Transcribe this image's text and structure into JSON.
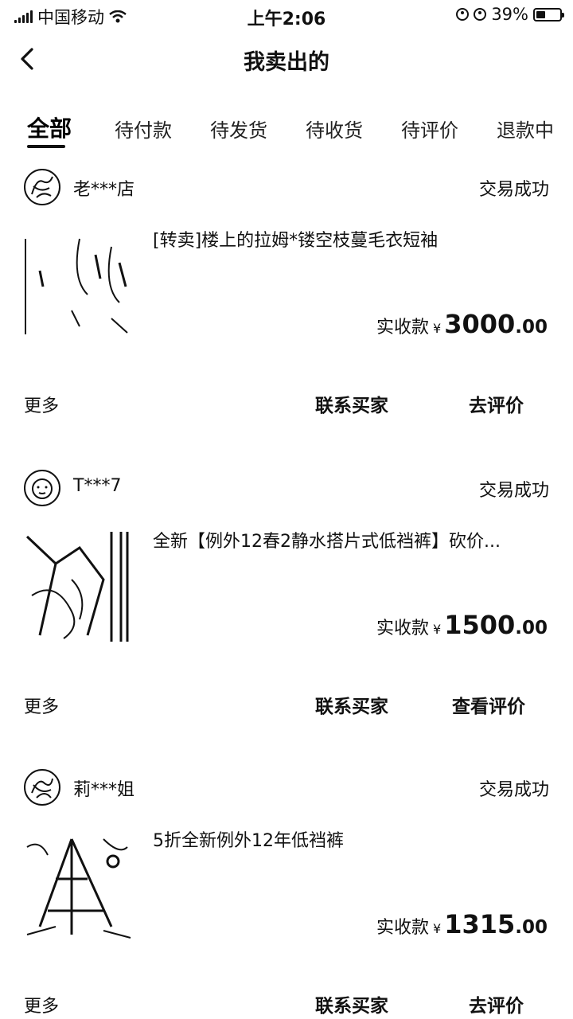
{
  "status_bar": {
    "carrier": "中国移动",
    "time": "上午2:06",
    "battery": "39%",
    "battery_level": 0.39
  },
  "nav": {
    "back_icon": "chevron-left-icon",
    "title": "我卖出的"
  },
  "tabs": [
    "全部",
    "待付款",
    "待发货",
    "待收货",
    "待评价",
    "退款中"
  ],
  "orders": [
    {
      "seller": "老***店",
      "status": "交易成功",
      "title": "[转卖]楼上的拉姆*镂空枝蔓毛衣短袖",
      "price_label": "实收款",
      "currency": "¥",
      "price_int": "3000",
      "price_dec": ".00",
      "more": "更多",
      "contact": "联系买家",
      "action": "去评价"
    },
    {
      "seller": "T***7",
      "status": "交易成功",
      "title": "全新【例外12春2静水搭片式低裆裤】砍价...",
      "price_label": "实收款",
      "currency": "¥",
      "price_int": "1500",
      "price_dec": ".00",
      "more": "更多",
      "contact": "联系买家",
      "action": "查看评价"
    },
    {
      "seller": "莉***姐",
      "status": "交易成功",
      "title": "5折全新例外12年低裆裤",
      "price_label": "实收款",
      "currency": "¥",
      "price_int": "1315",
      "price_dec": ".00",
      "more": "更多",
      "contact": "联系买家",
      "action": "去评价"
    }
  ]
}
